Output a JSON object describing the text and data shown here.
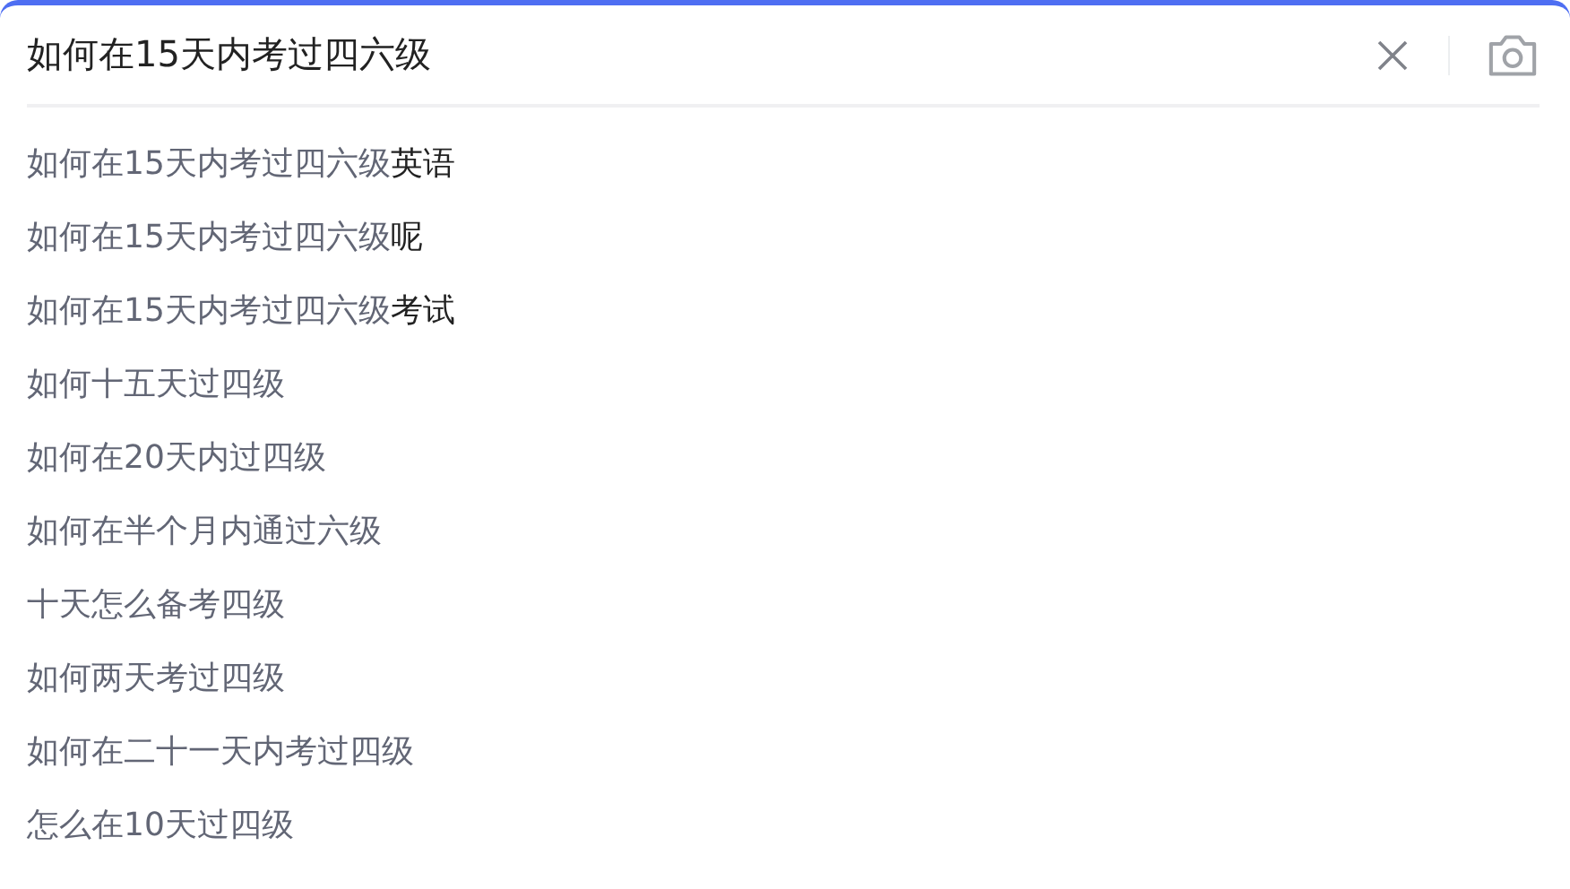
{
  "search": {
    "value": "如何在15天内考过四六级"
  },
  "suggestions": [
    {
      "match": "如何在15天内考过四六级",
      "rest": "英语"
    },
    {
      "match": "如何在15天内考过四六级",
      "rest": "呢"
    },
    {
      "match": "如何在15天内考过四六级",
      "rest": "考试"
    },
    {
      "match": "如何十五天过四级"
    },
    {
      "match": "如何在20天内过四级"
    },
    {
      "match": "如何在半个月内通过六级"
    },
    {
      "match": "十天怎么备考四级"
    },
    {
      "match": "如何两天考过四级"
    },
    {
      "match": "如何在二十一天内考过四级"
    },
    {
      "match": "怎么在10天过四级"
    }
  ]
}
